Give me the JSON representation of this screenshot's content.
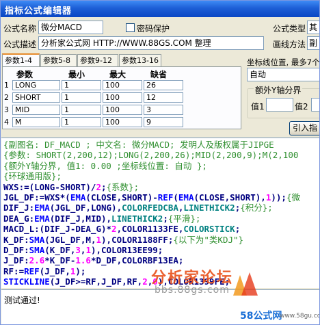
{
  "window": {
    "title": "指标公式编辑器",
    "accent": "#0a46c4"
  },
  "form": {
    "name_label": "公式名称",
    "name_value": "微分MACD",
    "password_label": "密码保护",
    "password_checked": false,
    "type_label": "公式类型",
    "type_value": "其",
    "desc_label": "公式描述",
    "desc_value": "分析家公式网 HTTP://WWW.88GS.COM 整理",
    "draw_label": "画线方法",
    "draw_value": "副"
  },
  "tabs": [
    {
      "label": "参数1-4",
      "active": true
    },
    {
      "label": "参数5-8",
      "active": false
    },
    {
      "label": "参数9-12",
      "active": false
    },
    {
      "label": "参数13-16",
      "active": false
    }
  ],
  "params": {
    "headers": [
      "参数",
      "最小",
      "最大",
      "缺省"
    ],
    "rows": [
      {
        "num": "1",
        "name": "LONG",
        "min": "1",
        "max": "100",
        "default": "26"
      },
      {
        "num": "2",
        "name": "SHORT",
        "min": "1",
        "max": "100",
        "default": "12"
      },
      {
        "num": "3",
        "name": "MID",
        "min": "1",
        "max": "100",
        "default": "3"
      },
      {
        "num": "4",
        "name": "M",
        "min": "1",
        "max": "100",
        "default": "9"
      }
    ]
  },
  "right_panel": {
    "axis_pos_label": "坐标线位置, 最多7个",
    "axis_pos_value": "自动",
    "group_label": "额外Y轴分界",
    "val1_label": "值1",
    "val2_label": "值2",
    "import_button": "引入指"
  },
  "code_lines": [
    [
      {
        "t": "{副图名: DF_MACD ; 中文名: 微分MACD; 发明人及版权属于JIPGE",
        "c": "c-comment"
      }
    ],
    [
      {
        "t": "{参数: SHORT(2,200,12);LONG(2,200,26);MID(2,200,9);M(2,100",
        "c": "c-comment"
      }
    ],
    [
      {
        "t": "{额外Y轴分界, 值1: 0.00 ;坐标线位置: 自动 };",
        "c": "c-comment"
      }
    ],
    [
      {
        "t": "{环球通用版};",
        "c": "c-comment"
      }
    ],
    [
      {
        "t": "WXS:=(LONG-SHORT)/",
        "c": "c-text"
      },
      {
        "t": "2",
        "c": "c-num"
      },
      {
        "t": ";",
        "c": "c-text"
      },
      {
        "t": "{系数};",
        "c": "c-comment"
      }
    ],
    [
      {
        "t": "JGL_DF:=WXS*(",
        "c": "c-text"
      },
      {
        "t": "EMA",
        "c": "c-func"
      },
      {
        "t": "(CLOSE,SHORT)-",
        "c": "c-text"
      },
      {
        "t": "REF",
        "c": "c-func"
      },
      {
        "t": "(",
        "c": "c-text"
      },
      {
        "t": "EMA",
        "c": "c-func"
      },
      {
        "t": "(CLOSE,SHORT),",
        "c": "c-text"
      },
      {
        "t": "1",
        "c": "c-num"
      },
      {
        "t": "));",
        "c": "c-text"
      },
      {
        "t": "{微",
        "c": "c-comment"
      }
    ],
    [
      {
        "t": "DIF_J:",
        "c": "c-text"
      },
      {
        "t": "EMA",
        "c": "c-func"
      },
      {
        "t": "(JGL_DF,LONG),",
        "c": "c-text"
      },
      {
        "t": "COLORFEDCBA",
        "c": "c-color"
      },
      {
        "t": ",",
        "c": "c-text"
      },
      {
        "t": "LINETHICK2",
        "c": "c-color"
      },
      {
        "t": ";",
        "c": "c-text"
      },
      {
        "t": "{积分};",
        "c": "c-comment"
      }
    ],
    [
      {
        "t": "DEA_G:",
        "c": "c-text"
      },
      {
        "t": "EMA",
        "c": "c-func"
      },
      {
        "t": "(DIF_J,MID),",
        "c": "c-text"
      },
      {
        "t": "LINETHICK2",
        "c": "c-color"
      },
      {
        "t": ";",
        "c": "c-text"
      },
      {
        "t": "{平滑};",
        "c": "c-comment"
      }
    ],
    [
      {
        "t": "MACD_L:(DIF_J-DEA_G)*",
        "c": "c-text"
      },
      {
        "t": "2",
        "c": "c-num"
      },
      {
        "t": ",COLOR1133FE,",
        "c": "c-text"
      },
      {
        "t": "COLORSTICK",
        "c": "c-color"
      },
      {
        "t": ";",
        "c": "c-text"
      }
    ],
    [
      {
        "t": "K_DF:",
        "c": "c-text"
      },
      {
        "t": "SMA",
        "c": "c-func"
      },
      {
        "t": "(JGL_DF,M,",
        "c": "c-text"
      },
      {
        "t": "1",
        "c": "c-num"
      },
      {
        "t": "),COLOR1188FF;",
        "c": "c-text"
      },
      {
        "t": "{以下为\"类KDJ\"}",
        "c": "c-comment"
      }
    ],
    [
      {
        "t": "D_DF:",
        "c": "c-text"
      },
      {
        "t": "SMA",
        "c": "c-func"
      },
      {
        "t": "(K_DF,",
        "c": "c-text"
      },
      {
        "t": "3",
        "c": "c-num"
      },
      {
        "t": ",",
        "c": "c-text"
      },
      {
        "t": "1",
        "c": "c-num"
      },
      {
        "t": "),COLOR13EE99;",
        "c": "c-text"
      }
    ],
    [
      {
        "t": "J_DF:",
        "c": "c-text"
      },
      {
        "t": "2.6",
        "c": "c-num"
      },
      {
        "t": "*K_DF-",
        "c": "c-text"
      },
      {
        "t": "1.6",
        "c": "c-num"
      },
      {
        "t": "*D_DF,COLORBF13EA;",
        "c": "c-text"
      }
    ],
    [
      {
        "t": "RF:=",
        "c": "c-text"
      },
      {
        "t": "REF",
        "c": "c-func"
      },
      {
        "t": "(J_DF,",
        "c": "c-text"
      },
      {
        "t": "1",
        "c": "c-num"
      },
      {
        "t": ");",
        "c": "c-text"
      }
    ],
    [
      {
        "t": "STICKLINE",
        "c": "c-func"
      },
      {
        "t": "(J_DF>=RF,J_DF,RF,",
        "c": "c-text"
      },
      {
        "t": "2",
        "c": "c-num"
      },
      {
        "t": ",",
        "c": "c-text"
      },
      {
        "t": "0",
        "c": "c-num"
      },
      {
        "t": "),COLOR1399FE;",
        "c": "c-text"
      }
    ]
  ],
  "status": {
    "text": "测试通过!"
  },
  "watermarks": {
    "logo_text": "分析家论坛",
    "url_text": "bbs.88gs.com",
    "corner_brand": "58公式网",
    "corner_url": "www.58gu.com"
  }
}
